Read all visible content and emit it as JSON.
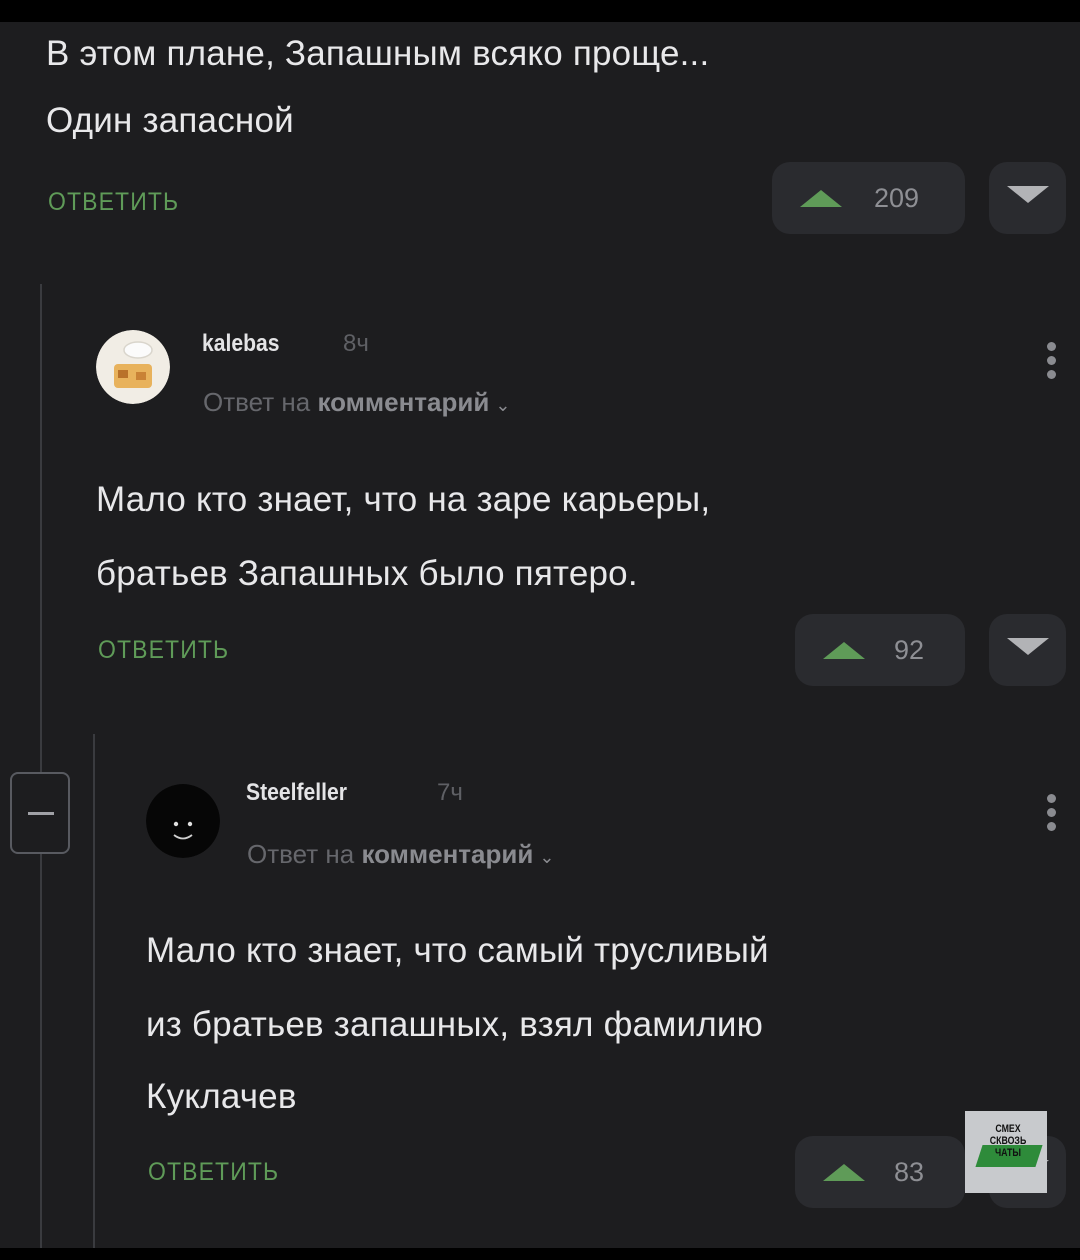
{
  "root_comment": {
    "text_line1": "В этом плане, Запашным всяко проще...",
    "text_line2": "Один запасной",
    "reply_label": "ОТВЕТИТЬ",
    "upvotes": "209"
  },
  "comment_kalebas": {
    "username": "kalebas",
    "time": "8ч",
    "reply_prefix": "Ответ на",
    "reply_target": "комментарий",
    "text_line1": "Мало кто знает, что на заре карьеры,",
    "text_line2": "братьев Запашных было пятеро.",
    "reply_label": "ОТВЕТИТЬ",
    "upvotes": "92"
  },
  "comment_steelfeller": {
    "username": "Steelfeller",
    "time": "7ч",
    "reply_prefix": "Ответ на",
    "reply_target": "комментарий",
    "text_line1": "Мало кто знает, что самый трусливый",
    "text_line2": "из братьев запашных, взял фамилию",
    "text_line3": "Куклачев",
    "reply_label": "ОТВЕТИТЬ",
    "upvotes": "83"
  },
  "watermark": {
    "text": "СМЕХ СКВОЗЬ ЧАТЫ"
  },
  "colors": {
    "background": "#1d1d1f",
    "accent_green": "#5f9b58",
    "text": "#e8e8ea",
    "button_bg": "#2a2b2f"
  },
  "icons": [
    "upvote-icon",
    "downvote-icon",
    "more-icon",
    "chevron-down-icon",
    "collapse-icon"
  ]
}
